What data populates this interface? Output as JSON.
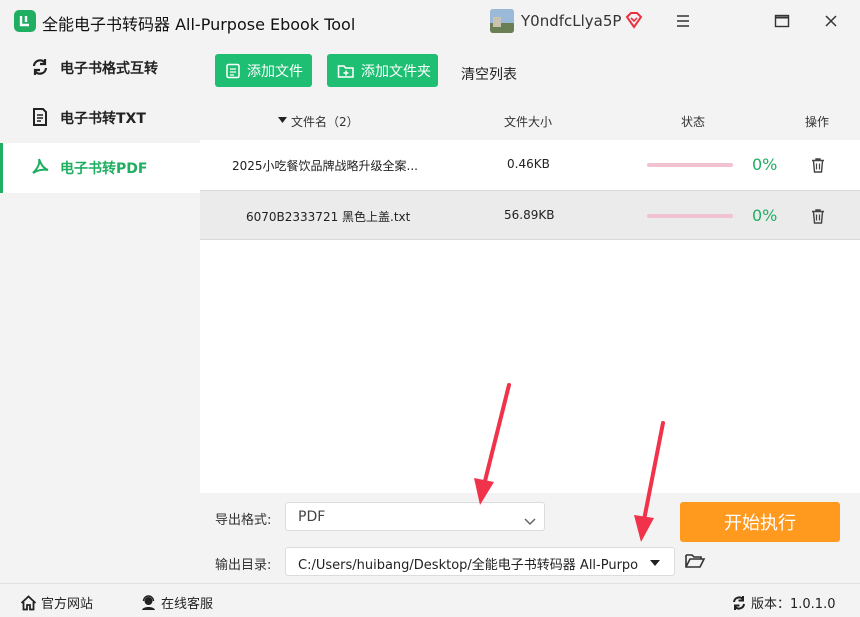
{
  "window": {
    "title": "全能电子书转码器 All-Purpose Ebook Tool",
    "username": "Y0ndfcLlya5P",
    "icons": [
      "app-logo-icon",
      "vip-diamond-icon",
      "menu-icon",
      "maximize-icon",
      "close-icon"
    ]
  },
  "sidebar": {
    "items": [
      {
        "label": "电子书格式互转",
        "icon": "refresh-icon",
        "active": false
      },
      {
        "label": "电子书转TXT",
        "icon": "document-icon",
        "active": false
      },
      {
        "label": "电子书转PDF",
        "icon": "pdf-icon",
        "active": true
      }
    ]
  },
  "toolbar": {
    "add_file": "添加文件",
    "add_folder": "添加文件夹",
    "clear_list": "清空列表"
  },
  "table": {
    "headers": {
      "name": "文件名（2）",
      "size": "文件大小",
      "status": "状态",
      "action": "操作"
    },
    "rows": [
      {
        "name": "2025小吃餐饮品牌战略升级全案...",
        "size": "0.46KB",
        "progress": 0,
        "progress_label": "0%"
      },
      {
        "name": "6070B2333721 黑色上盖.txt",
        "size": "56.89KB",
        "progress": 0,
        "progress_label": "0%"
      }
    ]
  },
  "settings": {
    "format_label": "导出格式:",
    "format_value": "PDF",
    "output_label": "输出目录:",
    "output_value": "C:/Users/huibang/Desktop/全能电子书转码器 All-Purpose Ebook Tool",
    "start_button": "开始执行"
  },
  "statusbar": {
    "website": "官方网站",
    "support": "在线客服",
    "version": "版本：1.0.1.0"
  },
  "colors": {
    "accent": "#1fae62",
    "button_green": "#1fbf73",
    "start_orange": "#ff9a1f",
    "annotation_red": "#f0324b"
  }
}
